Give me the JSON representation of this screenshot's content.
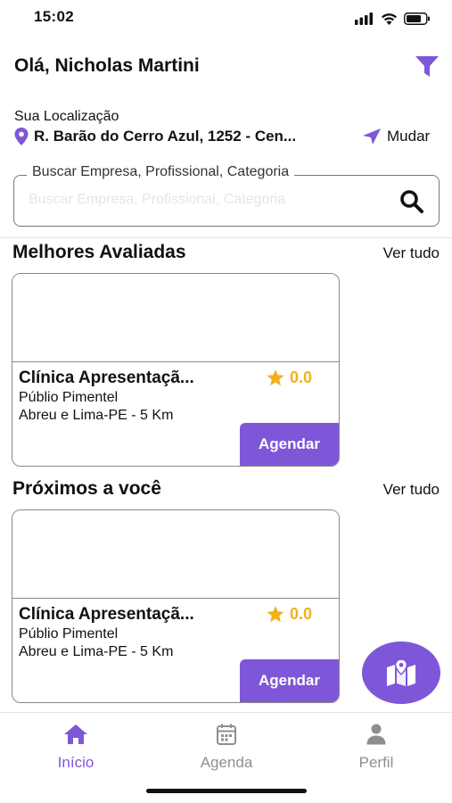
{
  "status_bar": {
    "time": "15:02",
    "icons": [
      "signal-icon",
      "wifi-icon",
      "battery-icon"
    ]
  },
  "header": {
    "greeting": "Olá, Nicholas Martini",
    "filter_icon": "filter-icon"
  },
  "location": {
    "label": "Sua Localização",
    "address": "R. Barão do Cerro Azul, 1252 - Cen...",
    "change_label": "Mudar"
  },
  "search": {
    "legend": "Buscar Empresa, Profissional, Categoria",
    "placeholder": "Buscar Empresa, Profissional, Categoria",
    "value": ""
  },
  "sections": [
    {
      "title": "Melhores Avaliadas",
      "see_all": "Ver tudo",
      "card": {
        "name": "Clínica Apresentaçã...",
        "rating": "0.0",
        "person": "Públio Pimentel",
        "address": "Abreu e Lima-PE - 5 Km",
        "button": "Agendar"
      }
    },
    {
      "title": "Próximos a você",
      "see_all": "Ver tudo",
      "card": {
        "name": "Clínica Apresentaçã...",
        "rating": "0.0",
        "person": "Públio Pimentel",
        "address": "Abreu e Lima-PE - 5 Km",
        "button": "Agendar"
      }
    }
  ],
  "map_button": {
    "icon": "map-icon"
  },
  "tabs": [
    {
      "label": "Início",
      "icon": "home-icon",
      "active": true
    },
    {
      "label": "Agenda",
      "icon": "calendar-icon",
      "active": false
    },
    {
      "label": "Perfil",
      "icon": "user-icon",
      "active": false
    }
  ],
  "colors": {
    "accent": "#7e57d9",
    "star": "#f2b01e",
    "inactive": "#8f8f8f"
  }
}
